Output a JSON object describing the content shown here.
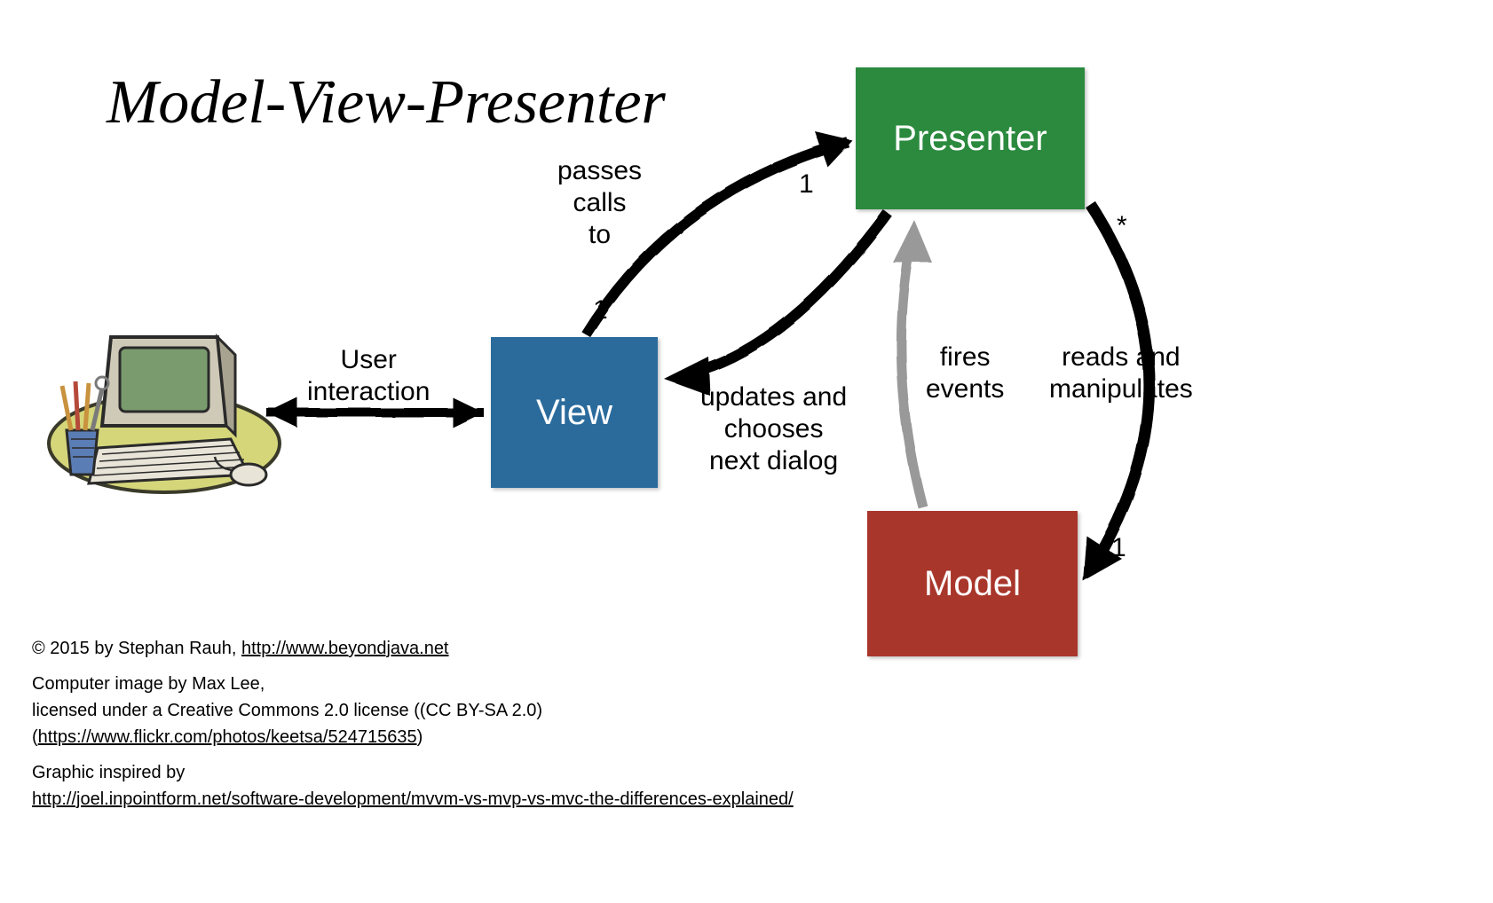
{
  "title": "Model-View-Presenter",
  "boxes": {
    "view": "View",
    "presenter": "Presenter",
    "model": "Model"
  },
  "labels": {
    "user_interaction": "User\ninteraction",
    "passes_calls_to": "passes\ncalls\nto",
    "updates_chooses": "updates and\nchooses\nnext dialog",
    "fires_events": "fires\nevents",
    "reads_manipulates": "reads and\nmanipulates"
  },
  "cardinalities": {
    "vp_presenter_end": "1",
    "vp_view_end": "1",
    "pm_presenter_end": "*",
    "pm_model_end": "1"
  },
  "credits": {
    "copyright_prefix": "© 2015 by Stephan Rauh, ",
    "copyright_link": "http://www.beyondjava.net",
    "img_line1": "Computer image by Max Lee,",
    "img_line2": "licensed under a Creative Commons 2.0 license ((CC BY-SA 2.0)",
    "img_link_prefix": "(",
    "img_link": "https://www.flickr.com/photos/keetsa/524715635",
    "img_link_suffix": ")",
    "inspired_prefix": "Graphic inspired by",
    "inspired_link": "http://joel.inpointform.net/software-development/mvvm-vs-mvp-vs-mvc-the-differences-explained/"
  }
}
